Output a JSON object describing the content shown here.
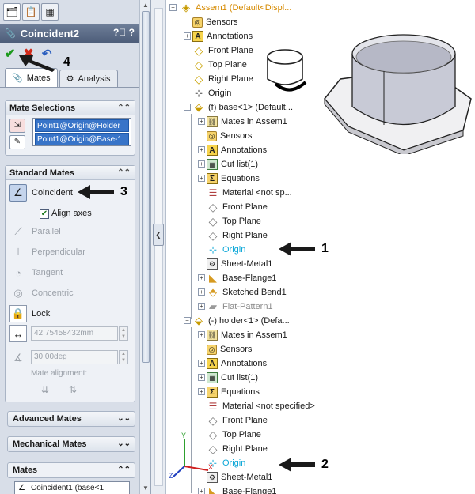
{
  "property_manager": {
    "title": "Coincident2",
    "tabs": [
      {
        "label": "Mates",
        "icon": "paperclip-icon"
      },
      {
        "label": "Analysis",
        "icon": "analysis-icon"
      }
    ],
    "mate_selections": {
      "header": "Mate Selections",
      "items": [
        "Point1@Origin@Holder",
        "Point1@Origin@Base-1"
      ]
    },
    "standard_mates": {
      "header": "Standard Mates",
      "coincident": "Coincident",
      "align_axes": "Align axes",
      "parallel": "Parallel",
      "perpendicular": "Perpendicular",
      "tangent": "Tangent",
      "concentric": "Concentric",
      "lock": "Lock",
      "distance_value": "42.75458432mm",
      "angle_value": "30.00deg",
      "mate_alignment": "Mate alignment:"
    },
    "advanced_mates": "Advanced Mates",
    "mechanical_mates": "Mechanical Mates",
    "mates": {
      "header": "Mates",
      "item": "Coincident1 (base<1"
    }
  },
  "callouts": {
    "c1": "1",
    "c2": "2",
    "c3": "3",
    "c4": "4"
  },
  "tree": {
    "root": "Assem1  (Default<Displ...",
    "sensors": "Sensors",
    "annotations": "Annotations",
    "front_plane": "Front Plane",
    "top_plane": "Top Plane",
    "right_plane": "Right Plane",
    "origin": "Origin",
    "base": {
      "label": "(f) base<1> (Default...",
      "mates_in": "Mates in Assem1",
      "sensors": "Sensors",
      "annotations": "Annotations",
      "cut_list": "Cut list(1)",
      "equations": "Equations",
      "material": "Material <not sp...",
      "front_plane": "Front Plane",
      "top_plane": "Top Plane",
      "right_plane": "Right Plane",
      "origin": "Origin",
      "sheet_metal": "Sheet-Metal1",
      "base_flange": "Base-Flange1",
      "sketched_bend": "Sketched Bend1",
      "flat_pattern": "Flat-Pattern1"
    },
    "holder": {
      "label": "(-) holder<1> (Defa...",
      "mates_in": "Mates in Assem1",
      "sensors": "Sensors",
      "annotations": "Annotations",
      "cut_list": "Cut list(1)",
      "equations": "Equations",
      "material": "Material <not specified>",
      "front_plane": "Front Plane",
      "top_plane": "Top Plane",
      "right_plane": "Right Plane",
      "origin": "Origin",
      "sheet_metal": "Sheet-Metal1",
      "base_flange": "Base-Flange1"
    }
  },
  "colors": {
    "accent_gold": "#d68a00",
    "origin_cyan": "#0fa8d8",
    "title_bar": "#4d5d79"
  }
}
